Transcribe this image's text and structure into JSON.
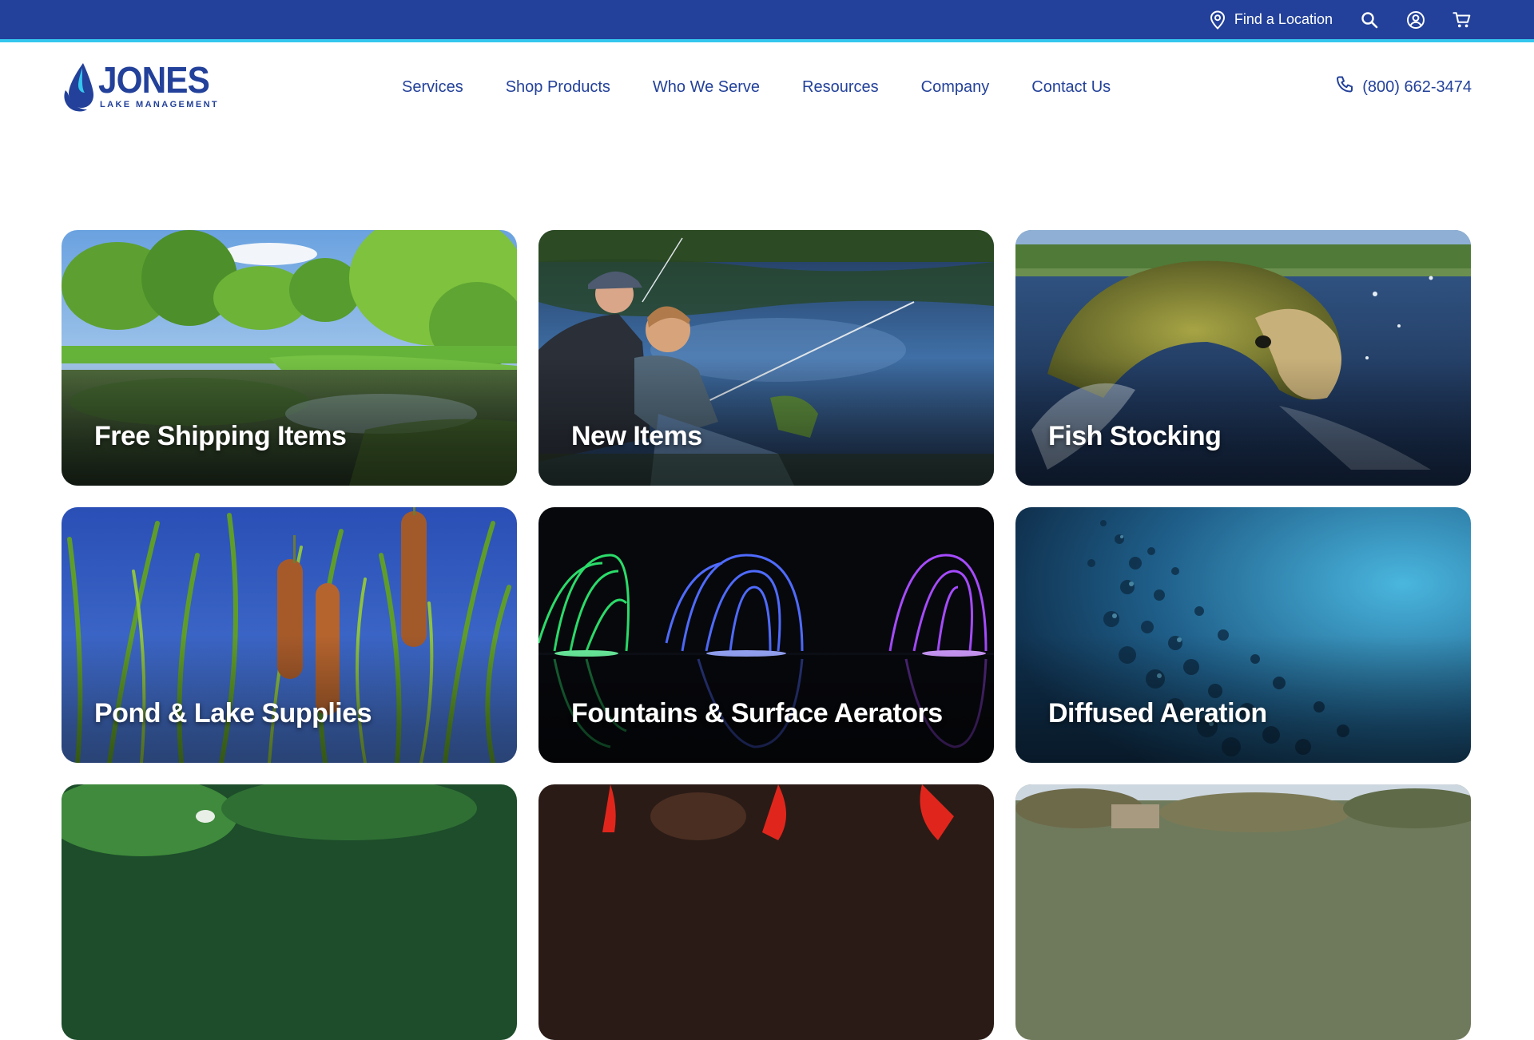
{
  "utility_bar": {
    "find_location_label": "Find a Location",
    "icons": [
      "location-pin-icon",
      "search-icon",
      "account-icon",
      "cart-icon"
    ]
  },
  "header": {
    "logo": {
      "wordmark": "JONES",
      "tagline": "LAKE MANAGEMENT"
    },
    "nav": [
      {
        "label": "Services"
      },
      {
        "label": "Shop Products"
      },
      {
        "label": "Who We Serve"
      },
      {
        "label": "Resources"
      },
      {
        "label": "Company"
      },
      {
        "label": "Contact Us"
      }
    ],
    "phone": "(800) 662-3474"
  },
  "categories": [
    {
      "label": "Free Shipping Items"
    },
    {
      "label": "New Items"
    },
    {
      "label": "Fish Stocking"
    },
    {
      "label": "Pond & Lake Supplies"
    },
    {
      "label": "Fountains & Surface Aerators"
    },
    {
      "label": "Diffused Aeration"
    },
    {
      "label": ""
    },
    {
      "label": ""
    },
    {
      "label": ""
    }
  ],
  "colors": {
    "brand_blue": "#23419a",
    "accent_cyan": "#34c6ee",
    "text_white": "#ffffff"
  }
}
